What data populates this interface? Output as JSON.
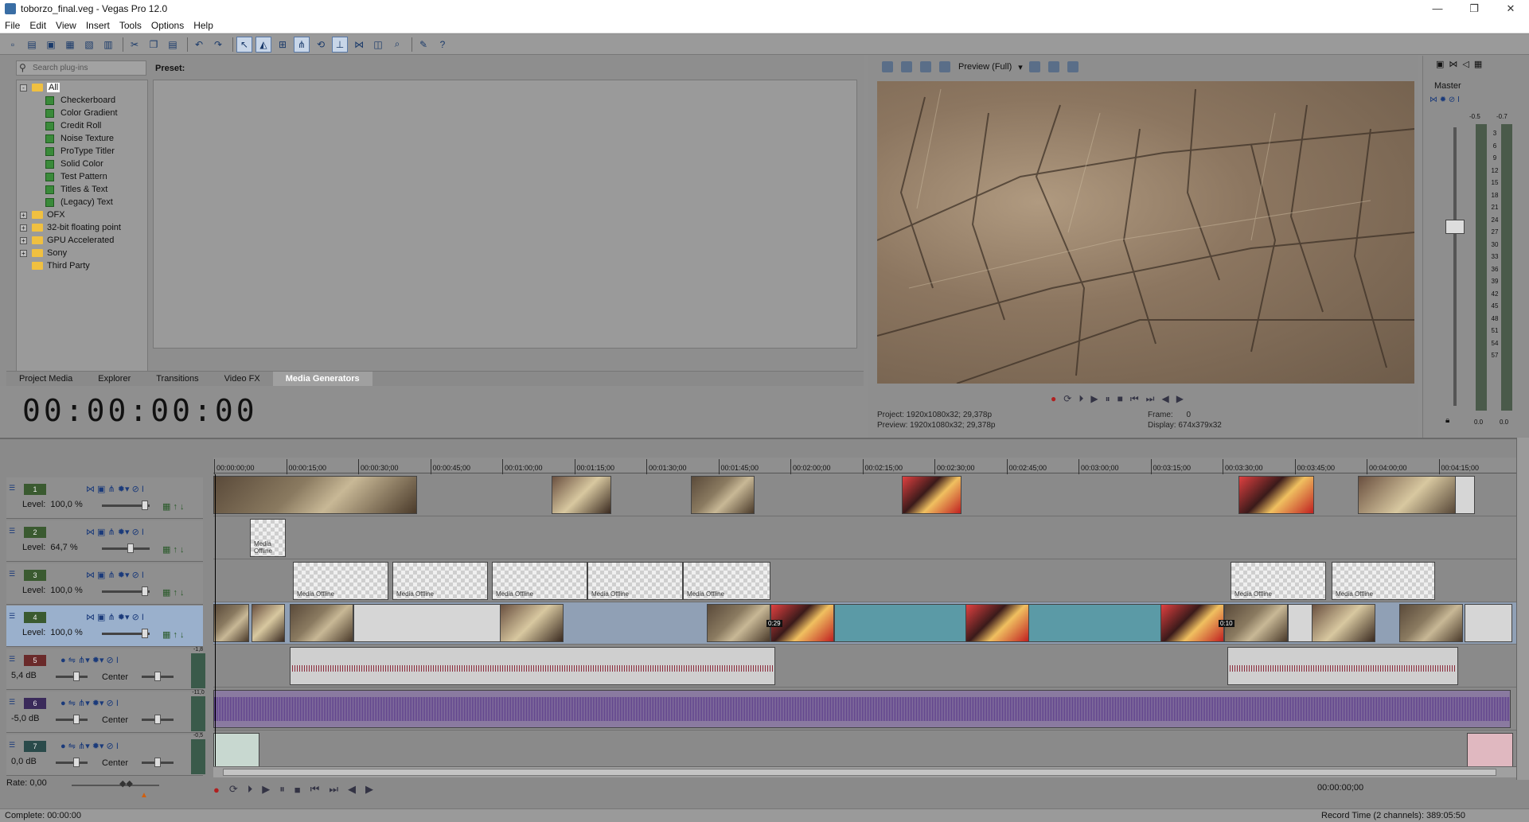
{
  "window": {
    "title": "toborzo_final.veg - Vegas Pro 12.0",
    "controls": [
      "—",
      "❐",
      "✕"
    ]
  },
  "menu": [
    "File",
    "Edit",
    "View",
    "Insert",
    "Tools",
    "Options",
    "Help"
  ],
  "plugins": {
    "search_placeholder": "Search plug-ins",
    "preset_label": "Preset:",
    "tree": [
      {
        "label": "All",
        "level": 0,
        "type": "folder",
        "expander": "-"
      },
      {
        "label": "Checkerboard",
        "level": 1,
        "type": "plugin"
      },
      {
        "label": "Color Gradient",
        "level": 1,
        "type": "plugin"
      },
      {
        "label": "Credit Roll",
        "level": 1,
        "type": "plugin"
      },
      {
        "label": "Noise Texture",
        "level": 1,
        "type": "plugin"
      },
      {
        "label": "ProType Titler",
        "level": 1,
        "type": "plugin"
      },
      {
        "label": "Solid Color",
        "level": 1,
        "type": "plugin"
      },
      {
        "label": "Test Pattern",
        "level": 1,
        "type": "plugin"
      },
      {
        "label": "Titles & Text",
        "level": 1,
        "type": "plugin"
      },
      {
        "label": "(Legacy) Text",
        "level": 1,
        "type": "plugin"
      },
      {
        "label": "OFX",
        "level": 0,
        "type": "folder",
        "expander": "+"
      },
      {
        "label": "32-bit floating point",
        "level": 0,
        "type": "folder",
        "expander": "+"
      },
      {
        "label": "GPU Accelerated",
        "level": 0,
        "type": "folder",
        "expander": "+"
      },
      {
        "label": "Sony",
        "level": 0,
        "type": "folder",
        "expander": "+"
      },
      {
        "label": "Third Party",
        "level": 0,
        "type": "folder",
        "expander": ""
      }
    ]
  },
  "tabs": [
    {
      "label": "Project Media",
      "active": false
    },
    {
      "label": "Explorer",
      "active": false
    },
    {
      "label": "Transitions",
      "active": false
    },
    {
      "label": "Video FX",
      "active": false
    },
    {
      "label": "Media Generators",
      "active": true
    }
  ],
  "timecode": "00:00:00:00",
  "preview": {
    "quality": "Preview (Full)",
    "project_label": "Project:",
    "project_value": "1920x1080x32; 29,378p",
    "preview_label": "Preview:",
    "preview_value": "1920x1080x32; 29,378p",
    "frame_label": "Frame:",
    "frame_value": "0",
    "display_label": "Display:",
    "display_value": "674x379x32"
  },
  "mixer": {
    "label": "Master",
    "peak_left": "-0.5",
    "peak_right": "-0.7",
    "scale": [
      "3",
      "6",
      "9",
      "12",
      "15",
      "18",
      "21",
      "24",
      "27",
      "30",
      "33",
      "36",
      "39",
      "42",
      "45",
      "48",
      "51",
      "54",
      "57"
    ],
    "bottom_left": "0.0",
    "bottom_right": "0.0"
  },
  "tracks": [
    {
      "num": "1",
      "kind": "video",
      "level_label": "Level:",
      "level": "100,0 %"
    },
    {
      "num": "2",
      "kind": "video",
      "level_label": "Level:",
      "level": "64,7 %"
    },
    {
      "num": "3",
      "kind": "video",
      "level_label": "Level:",
      "level": "100,0 %"
    },
    {
      "num": "4",
      "kind": "video",
      "level_label": "Level:",
      "level": "100,0 %",
      "selected": true
    },
    {
      "num": "5",
      "kind": "audio",
      "vol": "5,4 dB",
      "pan": "Center",
      "meter": "-1,8"
    },
    {
      "num": "6",
      "kind": "audio",
      "vol": "-5,0 dB",
      "pan": "Center",
      "meter": "-11,0"
    },
    {
      "num": "7",
      "kind": "audio",
      "vol": "0,0 dB",
      "pan": "Center",
      "meter": "-0,5"
    }
  ],
  "ruler": [
    "00:00:00;00",
    "00:00:15;00",
    "00:00:30;00",
    "00:00:45;00",
    "00:01:00;00",
    "00:01:15;00",
    "00:01:30;00",
    "00:01:45;00",
    "00:02:00;00",
    "00:02:15;00",
    "00:02:30;00",
    "00:02:45;00",
    "00:03:00;00",
    "00:03:15;00",
    "00:03:30;00",
    "00:03:45;00",
    "00:04:00;00",
    "00:04:15;00"
  ],
  "clip_labels": {
    "offline": "Media Offline",
    "m1": "0:29",
    "m2": "0:10"
  },
  "rate": "Rate: 0,00",
  "bottom_timecode": "00:00:00;00",
  "status": {
    "left": "Complete: 00:00:00",
    "right": "Record Time (2 channels): 389:05:50"
  }
}
